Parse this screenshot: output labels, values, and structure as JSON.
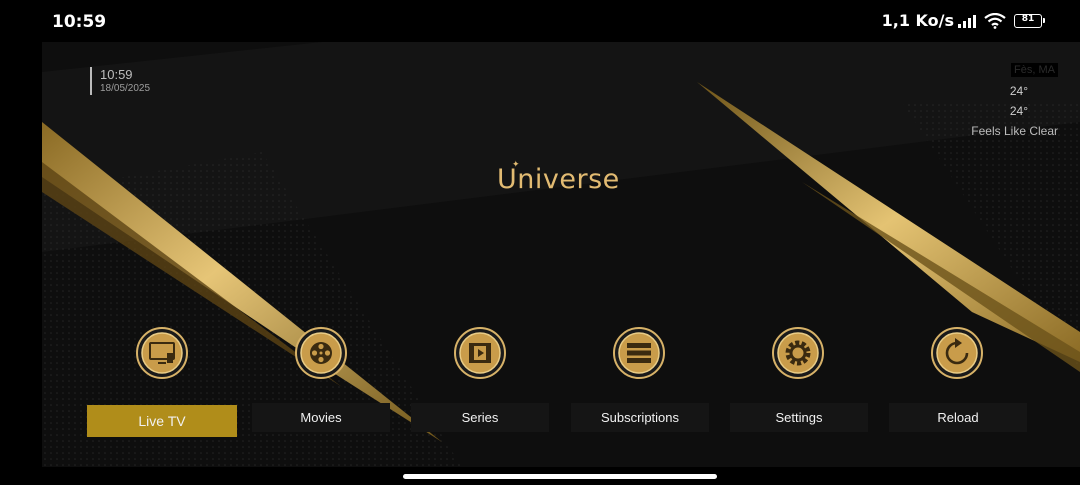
{
  "status_bar": {
    "time": "10:59",
    "network_speed": "1,1 Ko/s",
    "battery_level": "81",
    "icons": [
      "signal-icon",
      "wifi-icon",
      "battery-icon"
    ]
  },
  "clock": {
    "time": "10:59",
    "date": "18/05/2025"
  },
  "weather": {
    "location": "Fès, MA",
    "temp": "24°",
    "feels_like": "24°",
    "description": "Feels Like Clear"
  },
  "app": {
    "brand": "Universe"
  },
  "menu": {
    "items": [
      {
        "label": "Live TV",
        "icon": "tv-icon",
        "active": true
      },
      {
        "label": "Movies",
        "icon": "film-reel-icon",
        "active": false
      },
      {
        "label": "Series",
        "icon": "film-strip-play-icon",
        "active": false
      },
      {
        "label": "Subscriptions",
        "icon": "server-stack-icon",
        "active": false
      },
      {
        "label": "Settings",
        "icon": "gear-icon",
        "active": false
      },
      {
        "label": "Reload",
        "icon": "reload-icon",
        "active": false
      }
    ]
  },
  "colors": {
    "gold": "#e2bb72",
    "active_bg": "#b08d1a",
    "background": "#0e0e0e"
  }
}
